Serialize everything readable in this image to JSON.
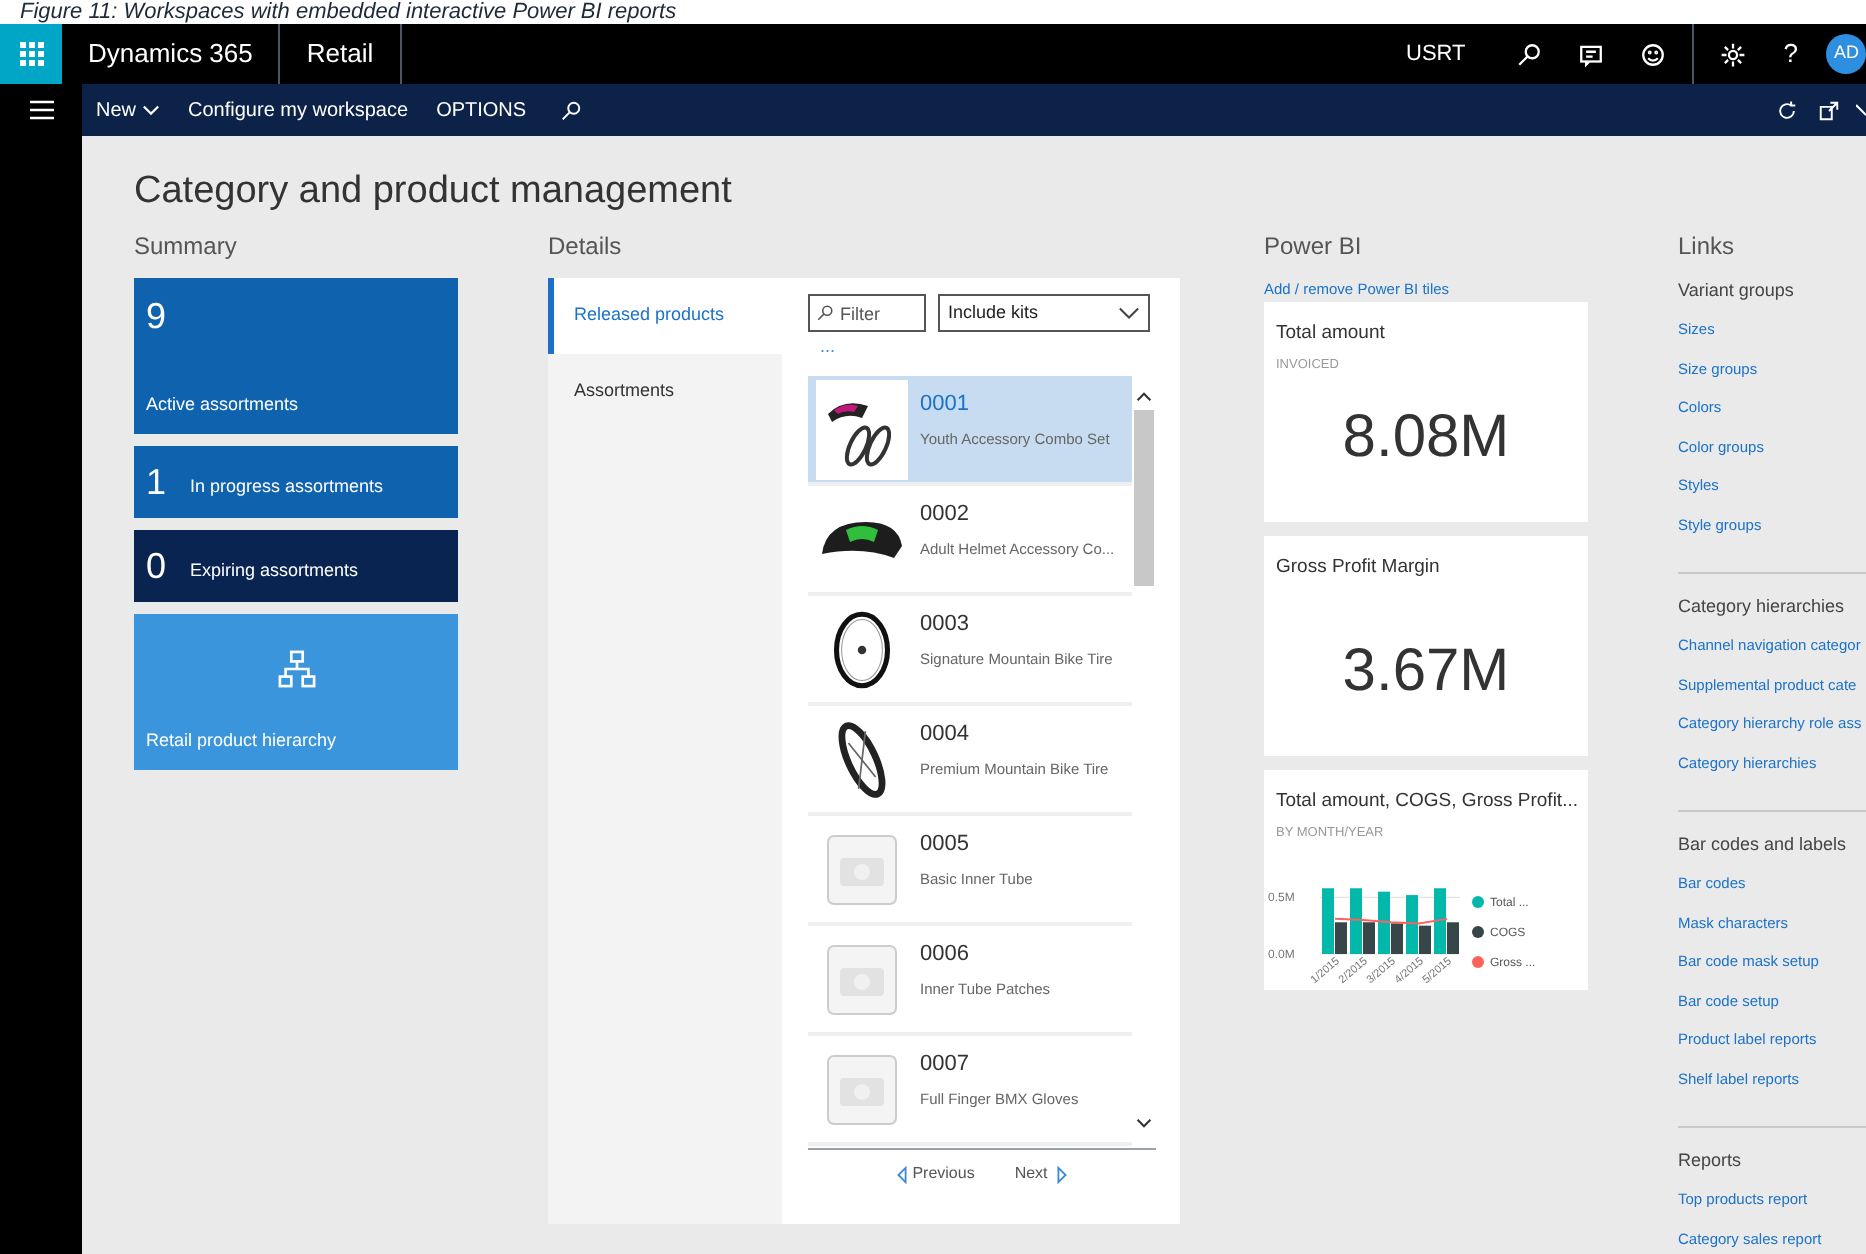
{
  "caption": "Figure 11: Workspaces with embedded interactive Power BI reports",
  "app_bar": {
    "product": "Dynamics 365",
    "module": "Retail",
    "company": "USRT",
    "help": "?",
    "avatar": "AD"
  },
  "action_bar": {
    "items": [
      {
        "label": "New",
        "dropdown": true
      },
      {
        "label": "Configure my workspace",
        "dropdown": false
      },
      {
        "label": "OPTIONS",
        "dropdown": false
      }
    ]
  },
  "page_title": "Category and product management",
  "summary": {
    "heading": "Summary",
    "tiles": [
      {
        "kind": "count",
        "count": "9",
        "label": "Active assortments",
        "color": "#0f63ae"
      },
      {
        "kind": "count-inline",
        "count": "1",
        "label": "In progress assortments",
        "color": "#0f63ae"
      },
      {
        "kind": "count-inline",
        "count": "0",
        "label": "Expiring assortments",
        "color": "#0a2452"
      },
      {
        "kind": "link",
        "label": "Retail product hierarchy",
        "color": "#3a95dc"
      }
    ]
  },
  "details": {
    "heading": "Details",
    "tabs": [
      {
        "label": "Released products",
        "selected": true
      },
      {
        "label": "Assortments",
        "selected": false
      }
    ],
    "filter": {
      "placeholder": "Filter"
    },
    "dropdown": {
      "value": "Include kits"
    },
    "more": "...",
    "products": [
      {
        "number": "0001",
        "name": "Youth Accessory Combo Set",
        "kind": "photo",
        "selected": true
      },
      {
        "number": "0002",
        "name": "Adult Helmet Accessory Co...",
        "kind": "photo",
        "selected": false
      },
      {
        "number": "0003",
        "name": "Signature Mountain Bike Tire",
        "kind": "photo",
        "selected": false
      },
      {
        "number": "0004",
        "name": "Premium Mountain Bike Tire",
        "kind": "photo",
        "selected": false
      },
      {
        "number": "0005",
        "name": "Basic Inner Tube",
        "kind": "no-image",
        "selected": false
      },
      {
        "number": "0006",
        "name": "Inner Tube Patches",
        "kind": "no-image",
        "selected": false
      },
      {
        "number": "0007",
        "name": "Full Finger BMX Gloves",
        "kind": "no-image",
        "selected": false
      }
    ],
    "previous": "Previous",
    "next": "Next"
  },
  "power_bi": {
    "heading": "Power BI",
    "add_link": "Add / remove Power BI tiles",
    "tiles": [
      {
        "kind": "kpi",
        "title": "Total amount",
        "subtitle": "INVOICED",
        "value": "8.08M"
      },
      {
        "kind": "kpi",
        "title": "Gross Profit Margin",
        "value": "3.67M"
      },
      {
        "kind": "chart",
        "title": "Total amount, COGS, Gross Profit...",
        "subtitle": "BY MONTH/YEAR",
        "chart_data": {
          "type": "bar",
          "categories": [
            "1/2015",
            "2/2015",
            "3/2015",
            "4/2015",
            "5/2015"
          ],
          "legend": "right",
          "ylim": [
            0,
            0.6
          ],
          "yticks": [
            {
              "value": 0,
              "label": "0.0M"
            },
            {
              "value": 0.5,
              "label": "0.5M"
            }
          ],
          "series": [
            {
              "name": "Total ...",
              "type": "bar",
              "color": "#01b8aa",
              "values": [
                0.58,
                0.58,
                0.55,
                0.52,
                0.58
              ]
            },
            {
              "name": "COGS",
              "type": "bar",
              "color": "#374649",
              "values": [
                0.28,
                0.28,
                0.27,
                0.25,
                0.28
              ]
            },
            {
              "name": "Gross ...",
              "type": "line",
              "color": "#fd625e",
              "values": [
                0.31,
                0.3,
                0.28,
                0.27,
                0.31
              ]
            }
          ]
        }
      }
    ]
  },
  "links": {
    "heading": "Links",
    "groups": [
      {
        "title": "Variant groups",
        "links": [
          "Sizes",
          "Size groups",
          "Colors",
          "Color groups",
          "Styles",
          "Style groups"
        ]
      },
      {
        "title": "Category hierarchies",
        "links": [
          "Channel navigation categor",
          "Supplemental product cate",
          "Category hierarchy role ass",
          "Category hierarchies"
        ]
      },
      {
        "title": "Bar codes and labels",
        "links": [
          "Bar codes",
          "Mask characters",
          "Bar code mask setup",
          "Bar code setup",
          "Product label reports",
          "Shelf label reports"
        ]
      },
      {
        "title": "Reports",
        "links": [
          "Top products report",
          "Category sales report"
        ]
      }
    ]
  }
}
